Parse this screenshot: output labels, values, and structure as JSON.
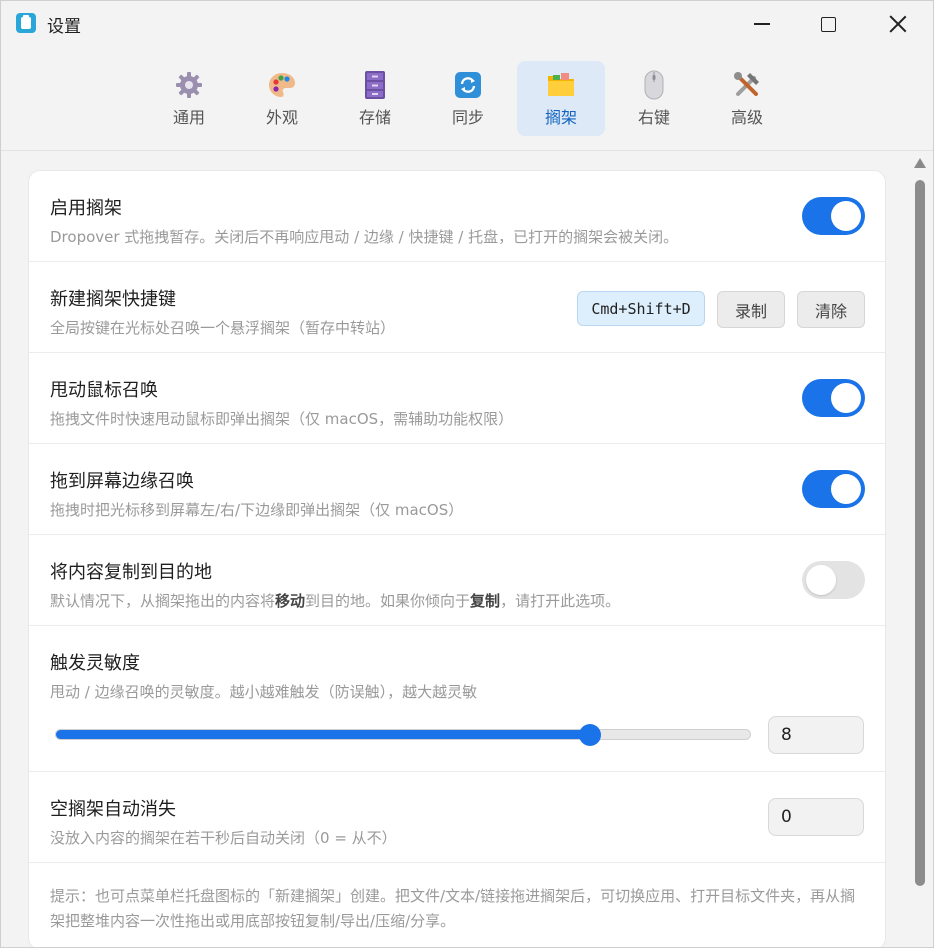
{
  "window": {
    "title": "设置"
  },
  "tabs": [
    {
      "label": "通用",
      "icon": "gear-icon",
      "active": false
    },
    {
      "label": "外观",
      "icon": "palette-icon",
      "active": false
    },
    {
      "label": "存储",
      "icon": "cabinet-icon",
      "active": false
    },
    {
      "label": "同步",
      "icon": "sync-icon",
      "active": false
    },
    {
      "label": "搁架",
      "icon": "folder-icon",
      "active": true
    },
    {
      "label": "右键",
      "icon": "mouse-icon",
      "active": false
    },
    {
      "label": "高级",
      "icon": "tools-icon",
      "active": false
    }
  ],
  "settings": {
    "enable": {
      "title": "启用搁架",
      "desc": "Dropover 式拖拽暂存。关闭后不再响应甩动 / 边缘 / 快捷键 / 托盘，已打开的搁架会被关闭。",
      "on": true
    },
    "shortcut": {
      "title": "新建搁架快捷键",
      "desc": "全局按键在光标处召唤一个悬浮搁架（暂存中转站）",
      "value": "Cmd+Shift+D",
      "record_label": "录制",
      "clear_label": "清除"
    },
    "shake": {
      "title": "甩动鼠标召唤",
      "desc": "拖拽文件时快速甩动鼠标即弹出搁架（仅 macOS，需辅助功能权限）",
      "on": true
    },
    "edge": {
      "title": "拖到屏幕边缘召唤",
      "desc": "拖拽时把光标移到屏幕左/右/下边缘即弹出搁架（仅 macOS）",
      "on": true
    },
    "copy": {
      "title": "将内容复制到目的地",
      "desc_prefix": "默认情况下，从搁架拖出的内容将",
      "desc_bold1": "移动",
      "desc_mid": "到目的地。如果你倾向于",
      "desc_bold2": "复制",
      "desc_suffix": "，请打开此选项。",
      "on": false
    },
    "sensitivity": {
      "title": "触发灵敏度",
      "desc": "甩动 / 边缘召唤的灵敏度。越小越难触发（防误触），越大越灵敏",
      "value": "8",
      "fraction": 0.77
    },
    "autoclose": {
      "title": "空搁架自动消失",
      "desc": "没放入内容的搁架在若干秒后自动关闭（0 = 从不）",
      "value": "0"
    }
  },
  "hint": "提示：也可点菜单栏托盘图标的「新建搁架」创建。把文件/文本/链接拖进搁架后，可切换应用、打开目标文件夹，再从搁架把整堆内容一次性拖出或用底部按钮复制/导出/压缩/分享。",
  "colors": {
    "accent": "#1a73e8",
    "active_tab_bg": "#dde9f7"
  }
}
